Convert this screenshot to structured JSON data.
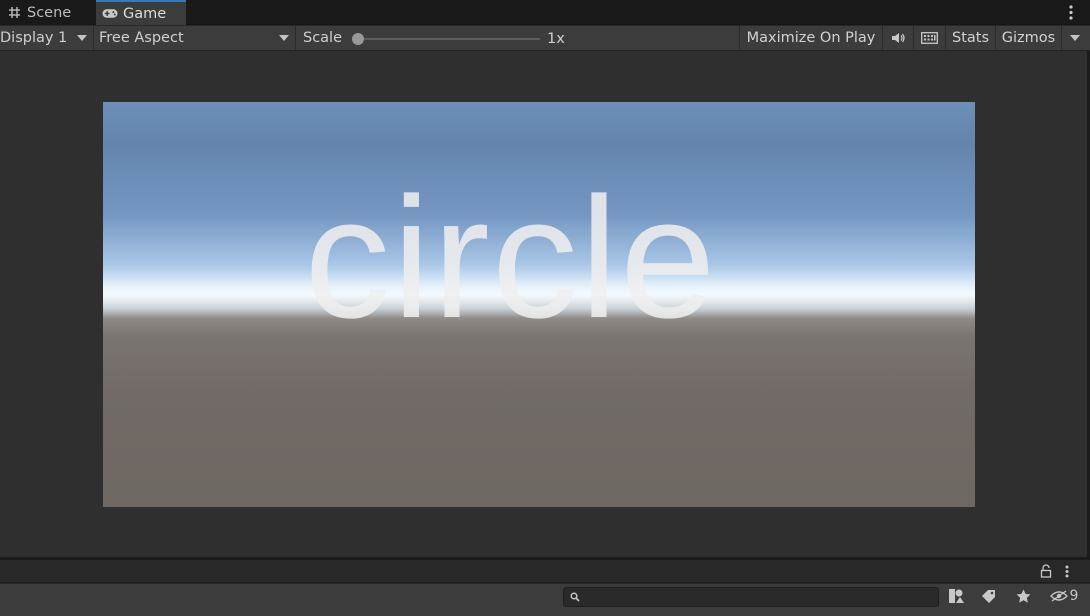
{
  "tabs": [
    {
      "label": "Scene",
      "icon": "grid-icon",
      "active": false
    },
    {
      "label": "Game",
      "icon": "gamepad-icon",
      "active": true
    }
  ],
  "toolbar": {
    "display": "Display 1",
    "aspect": "Free Aspect",
    "scale_label": "Scale",
    "scale_value": "1x",
    "scale_slider": 0,
    "maximize_on_play": "Maximize On Play",
    "stats": "Stats",
    "gizmos": "Gizmos"
  },
  "game_view": {
    "text": "circle"
  },
  "bottom": {
    "search_placeholder": "",
    "hidden_count": "9"
  },
  "colors": {
    "accent": "#3a79bb",
    "panel": "#3c3c3c",
    "background": "#282828"
  }
}
